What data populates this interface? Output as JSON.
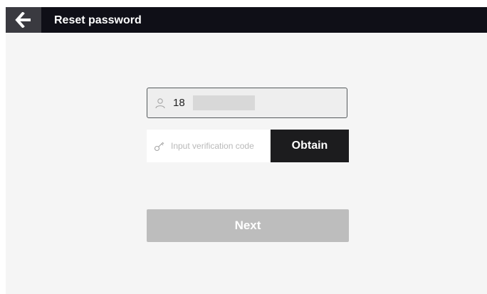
{
  "header": {
    "title": "Reset password",
    "back_icon": "arrow-left-icon"
  },
  "form": {
    "phone": {
      "icon": "user-icon",
      "value": "18",
      "masked": true
    },
    "verification": {
      "icon": "key-icon",
      "placeholder": "Input verification code",
      "value": "",
      "button_label": "Obtain"
    },
    "next_label": "Next"
  },
  "colors": {
    "header_bg": "#0f0f17",
    "back_button_bg": "#3a3a40",
    "page_bg": "#f5f5f5",
    "obtain_bg": "#1c1c1e",
    "next_disabled_bg": "#bdbdbd"
  }
}
